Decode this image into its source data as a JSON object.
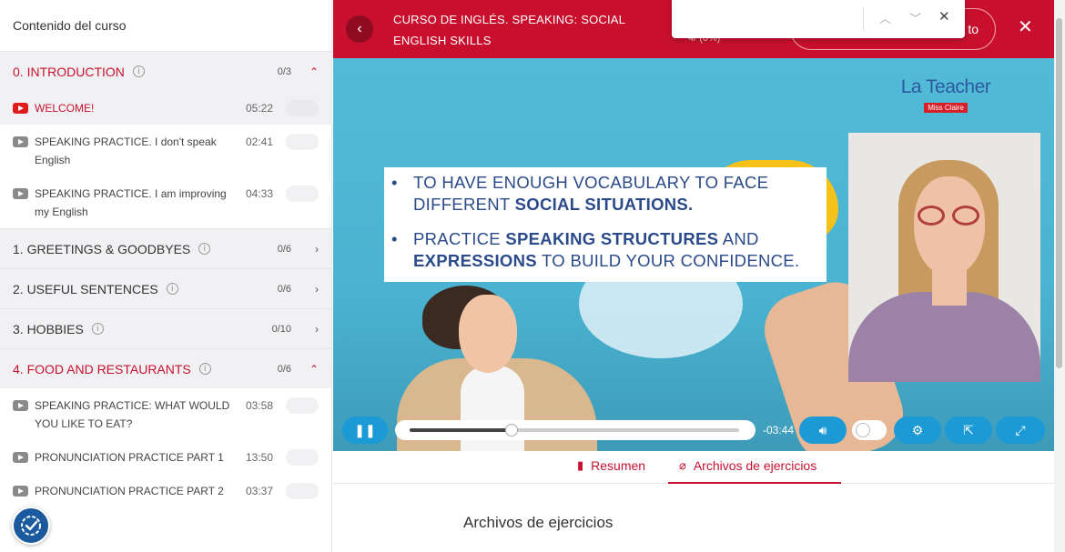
{
  "sidebar": {
    "title": "Contenido del curso",
    "sections": [
      {
        "name": "0. INTRODUCTION",
        "count": "0/3",
        "expanded": true,
        "lessons": [
          {
            "title": "WELCOME!",
            "duration": "05:22",
            "active": true
          },
          {
            "title": "SPEAKING PRACTICE. I don't speak English",
            "duration": "02:41"
          },
          {
            "title": "SPEAKING PRACTICE. I am improving my English",
            "duration": "04:33"
          }
        ]
      },
      {
        "name": "1. GREETINGS & GOODBYES",
        "count": "0/6",
        "expanded": false
      },
      {
        "name": "2. USEFUL SENTENCES",
        "count": "0/6",
        "expanded": false
      },
      {
        "name": "3. HOBBIES",
        "count": "0/10",
        "expanded": false
      },
      {
        "name": "4. FOOD AND RESTAURANTS",
        "count": "0/6",
        "expanded": true,
        "lessons": [
          {
            "title": "SPEAKING PRACTICE: WHAT WOULD YOU LIKE TO EAT?",
            "duration": "03:58"
          },
          {
            "title": "PRONUNCIATION PRACTICE PART 1",
            "duration": "13:50"
          },
          {
            "title": "PRONUNCIATION PRACTICE PART 2",
            "duration": "03:37"
          }
        ]
      }
    ]
  },
  "header": {
    "course_title": "CURSO DE INGLÉS. SPEAKING: SOCIAL ENGLISH SKILLS",
    "progress_text": "4/ (0%)",
    "outline_button_label": "to",
    "accent_color": "#c8102e"
  },
  "findbar": {
    "up_icon": "chevron-up-icon",
    "down_icon": "chevron-down-icon",
    "close_icon": "close-icon"
  },
  "video": {
    "logo_title": "La Teacher",
    "logo_subtitle": "Miss Claire",
    "slide": {
      "line1_a": "TO HAVE ENOUGH VOCABULARY TO FACE",
      "line1_b_normal": "DIFFERENT ",
      "line1_b_bold": "SOCIAL SITUATIONS.",
      "line2_a_normal": "PRACTICE ",
      "line2_a_bold": "SPEAKING STRUCTURES",
      "line2_a_tail": " AND",
      "line2_b_bold": "EXPRESSIONS",
      "line2_b_tail": " TO BUILD YOUR CONFIDENCE."
    },
    "time_remaining": "-03:44",
    "progress_fraction": 0.31,
    "control_color": "#1c9ad6"
  },
  "tabs": [
    {
      "label": "Resumen",
      "icon": "document-icon",
      "active": false
    },
    {
      "label": "Archivos de ejercicios",
      "icon": "paperclip-icon",
      "active": true
    }
  ],
  "content": {
    "heading": "Archivos de ejercicios"
  }
}
